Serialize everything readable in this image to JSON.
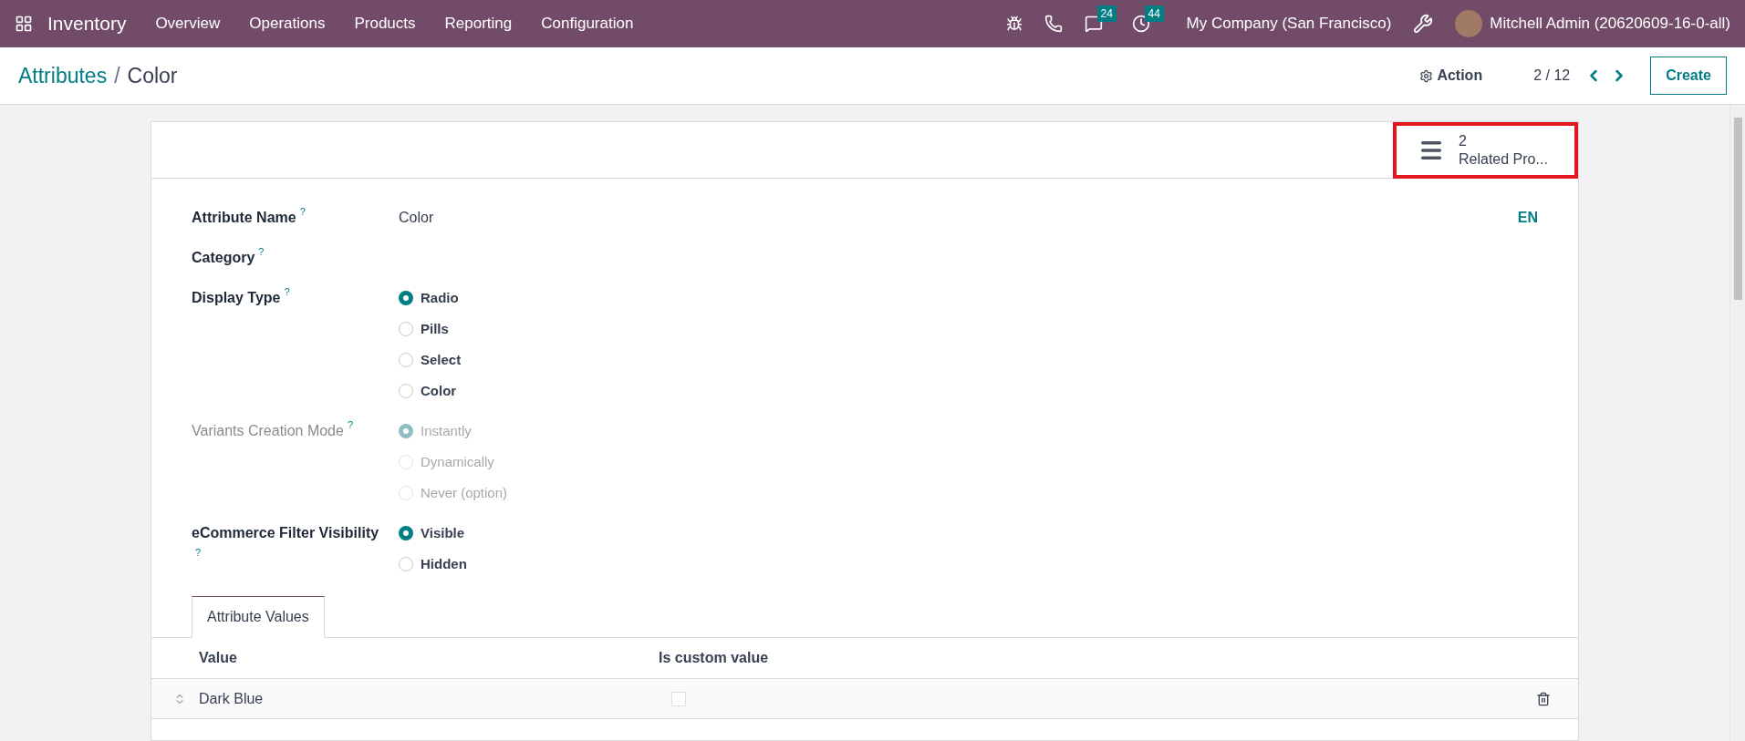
{
  "navbar": {
    "app_name": "Inventory",
    "menu": [
      "Overview",
      "Operations",
      "Products",
      "Reporting",
      "Configuration"
    ],
    "messages_count": "24",
    "activities_count": "44",
    "company": "My Company (San Francisco)",
    "user": "Mitchell Admin (20620609-16-0-all)"
  },
  "control_panel": {
    "breadcrumb": [
      {
        "label": "Attributes",
        "kind": "link"
      },
      {
        "label": "/",
        "kind": "separator"
      },
      {
        "label": "Color",
        "kind": "current"
      }
    ],
    "action": "Action",
    "pager": "2 / 12",
    "create": "Create"
  },
  "smart_button": {
    "count": "2",
    "label": "Related Pro...",
    "highlighted": true
  },
  "fields": [
    {
      "label": "Attribute Name",
      "help": "?",
      "value": "Color",
      "kind": "text",
      "disabled": false,
      "lang": "EN"
    },
    {
      "label": "Category",
      "help": "?",
      "kind": "text",
      "disabled": false
    },
    {
      "label": "Display Type",
      "help": "?",
      "kind": "radio",
      "disabled": false,
      "options": [
        {
          "label": "Radio",
          "selected": true
        },
        {
          "label": "Pills",
          "selected": false
        },
        {
          "label": "Select",
          "selected": false
        },
        {
          "label": "Color",
          "selected": false
        }
      ]
    },
    {
      "label": "Variants Creation Mode",
      "help": "?",
      "kind": "radio",
      "disabled": true,
      "options": [
        {
          "label": "Instantly",
          "selected": true
        },
        {
          "label": "Dynamically",
          "selected": false
        },
        {
          "label": "Never (option)",
          "selected": false
        }
      ]
    },
    {
      "label": "eCommerce Filter Visibility",
      "help": "?",
      "kind": "radio",
      "disabled": false,
      "options": [
        {
          "label": "Visible",
          "selected": true
        },
        {
          "label": "Hidden",
          "selected": false
        }
      ]
    }
  ],
  "tabs": [
    {
      "label": "Attribute Values",
      "selected": true
    }
  ],
  "table": {
    "columns": [
      "Value",
      "Is custom value"
    ],
    "rows": [
      {
        "value": "Dark Blue",
        "is_custom": false
      }
    ]
  }
}
